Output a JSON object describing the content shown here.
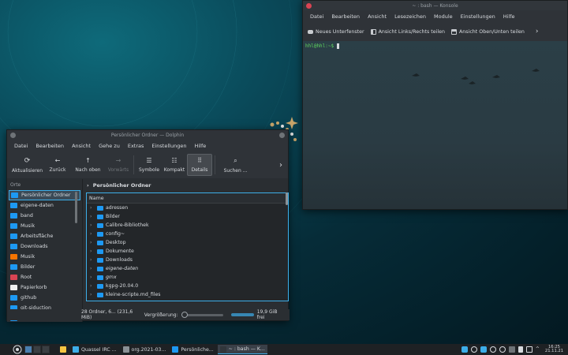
{
  "konsole": {
    "title": "~ : bash — Konsole",
    "menu": [
      "Datei",
      "Bearbeiten",
      "Ansicht",
      "Lesezeichen",
      "Module",
      "Einstellungen",
      "Hilfe"
    ],
    "toolbar": {
      "new_tab": "Neues Unterfenster",
      "split_lr": "Ansicht Links/Rechts teilen",
      "split_tb": "Ansicht Oben/Unten teilen"
    },
    "prompt": "hhl@hhl:~$"
  },
  "dolphin": {
    "title": "Persönlicher Ordner — Dolphin",
    "menu": [
      "Datei",
      "Bearbeiten",
      "Ansicht",
      "Gehe zu",
      "Extras",
      "Einstellungen",
      "Hilfe"
    ],
    "toolbar": {
      "refresh": "Aktualisieren",
      "back": "Zurück",
      "up": "Nach oben",
      "forward": "Vorwärts",
      "icons": "Symbole",
      "compact": "Kompakt",
      "details": "Details",
      "search": "Suchen ..."
    },
    "sidebar": {
      "heading": "Orte",
      "items": [
        {
          "label": "Persönlicher Ordner",
          "color": "#1d99f3"
        },
        {
          "label": "eigene-daten",
          "color": "#1d99f3"
        },
        {
          "label": "band",
          "color": "#1d99f3"
        },
        {
          "label": "Musik",
          "color": "#1d99f3"
        },
        {
          "label": "Arbeitsfläche",
          "color": "#1d99f3"
        },
        {
          "label": "Downloads",
          "color": "#1d99f3"
        },
        {
          "label": "Musik",
          "color": "#f67400"
        },
        {
          "label": "Bilder",
          "color": "#1d99f3"
        },
        {
          "label": "Root",
          "color": "#da4453"
        },
        {
          "label": "Papierkorb",
          "color": "#eff0f1"
        },
        {
          "label": "github",
          "color": "#1d99f3"
        },
        {
          "label": "git-siduction",
          "color": "#1d99f3"
        },
        {
          "label": "sddm",
          "color": "#1d99f3"
        }
      ]
    },
    "breadcrumb": "Persönlicher Ordner",
    "column_header": "Name",
    "files": [
      {
        "name": "adressen",
        "italic": false
      },
      {
        "name": "Bilder",
        "italic": false
      },
      {
        "name": "Calibre-Bibliothek",
        "italic": false
      },
      {
        "name": "config~",
        "italic": false
      },
      {
        "name": "Desktop",
        "italic": false
      },
      {
        "name": "Dokumente",
        "italic": false
      },
      {
        "name": "Downloads",
        "italic": false
      },
      {
        "name": "eigene-daten",
        "italic": true
      },
      {
        "name": "gmx",
        "italic": true
      },
      {
        "name": "kgpg-20.04.0",
        "italic": false
      },
      {
        "name": "kleine-scripte.md_files",
        "italic": false
      }
    ],
    "status": {
      "summary": "28 Ordner, 6... (231,6 MiB)",
      "zoom_label": "Vergrößerung:",
      "free": "19,9 GiB frei"
    }
  },
  "taskbar": {
    "tasks": [
      {
        "label": "",
        "color": "#f6c542"
      },
      {
        "label": "Quassel IRC ...",
        "color": "#3daee9"
      },
      {
        "label": "org.2021-03...",
        "color": "#8a9095"
      },
      {
        "label": "Persönliche...",
        "color": "#1d99f3"
      },
      {
        "label": "~ : bash — K...",
        "color": "#31363b"
      }
    ],
    "clock_time": "16:25",
    "clock_date": "21.11.21"
  },
  "colors": {
    "accent": "#3daee9",
    "close": "#da4453",
    "prompt": "#5fd75f"
  }
}
